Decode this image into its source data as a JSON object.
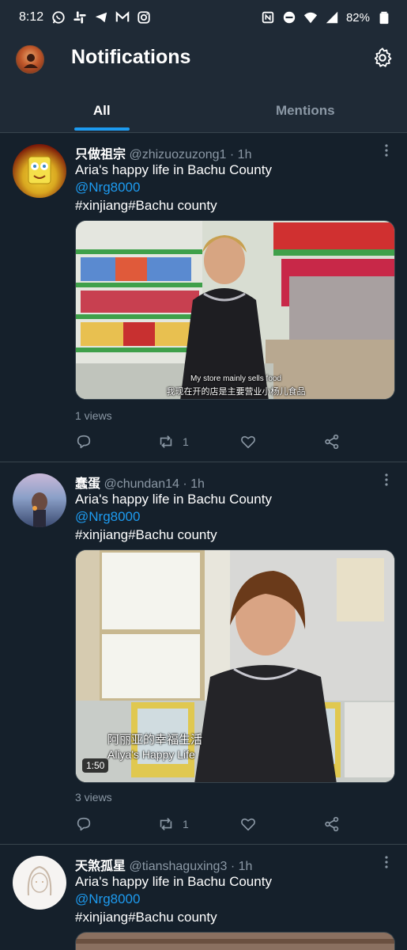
{
  "status_bar": {
    "time": "8:12",
    "battery": "82%",
    "left_icons": [
      "whatsapp-icon",
      "slack-icon",
      "telegram-icon",
      "gmail-icon",
      "instagram-icon"
    ],
    "right_icons": [
      "nfc-icon",
      "dnd-icon",
      "wifi-icon",
      "signal-icon",
      "battery-icon"
    ]
  },
  "header": {
    "title": "Notifications",
    "settings_icon": "gear-icon"
  },
  "tabs": [
    {
      "label": "All",
      "active": true
    },
    {
      "label": "Mentions",
      "active": false
    }
  ],
  "colors": {
    "background": "#15202b",
    "header": "#1f2a36",
    "accent": "#1d9bf0",
    "muted": "#8b98a5",
    "divider": "#38444d"
  },
  "tweets": [
    {
      "name": "只做祖宗",
      "handle": "@zhizuozuzong1",
      "time": "· 1h",
      "text": "Aria's happy life in Bachu County",
      "mention": "@Nrg8000",
      "hashtags": "#xinjiang#Bachu county",
      "media": {
        "subtitle_en": "My store mainly sells food",
        "subtitle_cn": "我现在开的店是主要营业小杨儿食品"
      },
      "views": "1 views",
      "retweets": "1"
    },
    {
      "name": "蠢蛋",
      "handle": "@chundan14",
      "time": "· 1h",
      "text": "Aria's happy life in Bachu County",
      "mention": "@Nrg8000",
      "hashtags": "#xinjiang#Bachu county",
      "media": {
        "subtitle_cn": "阿丽亚的幸福生活",
        "subtitle_en": "Aliya's Happy Life",
        "duration": "1:50"
      },
      "views": "3 views",
      "retweets": "1"
    },
    {
      "name": "天煞孤星",
      "handle": "@tianshaguxing3",
      "time": "· 1h",
      "text": "Aria's happy life in Bachu County",
      "mention": "@Nrg8000",
      "hashtags": "#xinjiang#Bachu county"
    }
  ]
}
